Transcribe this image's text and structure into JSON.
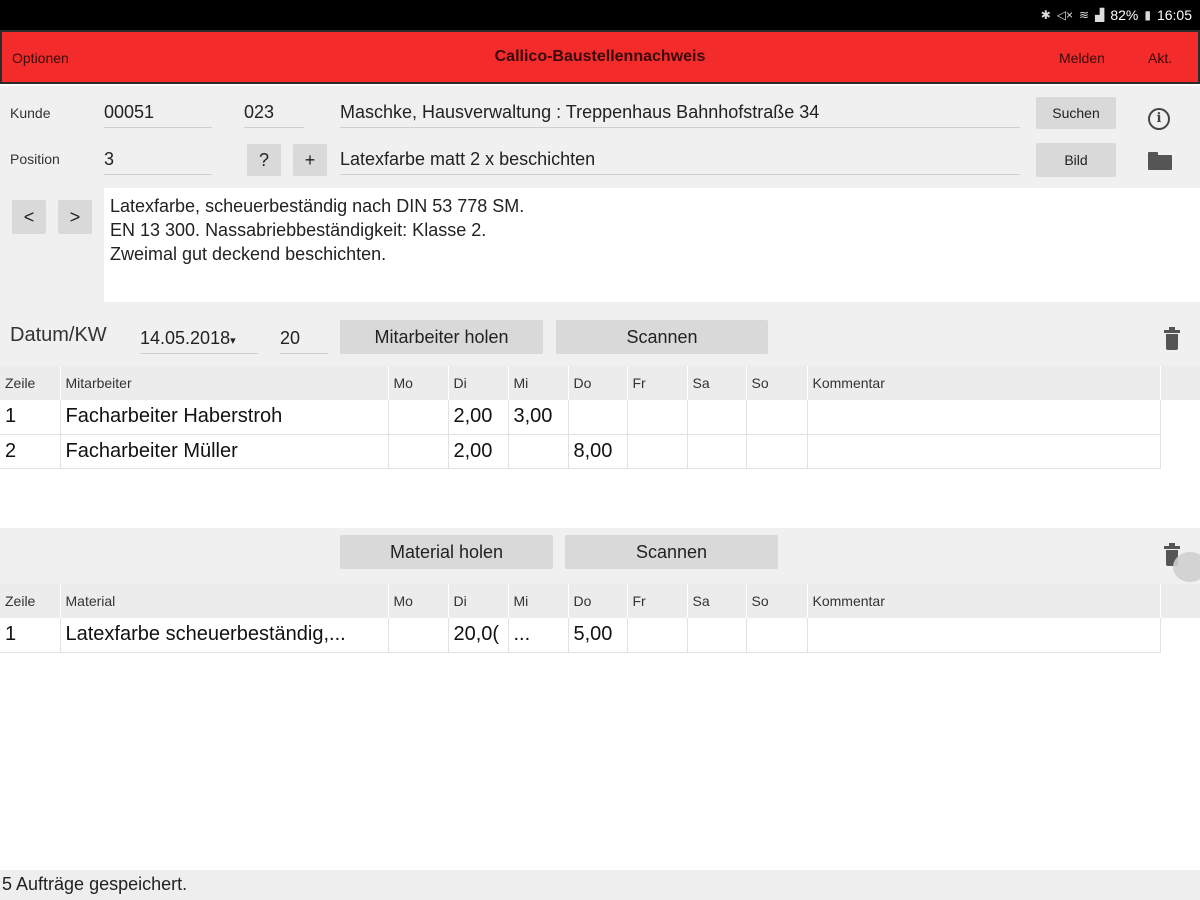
{
  "status": {
    "icons": [
      "bluetooth-icon",
      "mute-icon",
      "wifi-icon",
      "signal-icon",
      "battery-icon"
    ],
    "battery": "82%",
    "time": "16:05"
  },
  "appbar": {
    "options": "Optionen",
    "title": "Callico-Baustellennachweis",
    "melden": "Melden",
    "akt": "Akt."
  },
  "header": {
    "kunde_label": "Kunde",
    "kunde_nr": "00051",
    "kunde_sub": "023",
    "kunde_name": "Maschke, Hausverwaltung : Treppenhaus Bahnhofstraße 34",
    "suchen": "Suchen",
    "position_label": "Position",
    "position_nr": "3",
    "question_btn": "?",
    "plus_btn": "+",
    "position_text": "Latexfarbe matt 2 x beschichten",
    "bild": "Bild",
    "prev_btn": "<",
    "next_btn": ">",
    "description": [
      "Latexfarbe, scheuerbeständig nach DIN 53 778 SM.",
      "EN 13 300. Nassabriebbeständigkeit: Klasse 2.",
      "Zweimal gut deckend beschichten."
    ]
  },
  "employees": {
    "datum_label": "Datum/KW",
    "datum_value": "14.05.2018",
    "kw_value": "20",
    "fetch_button": "Mitarbeiter holen",
    "scan_button": "Scannen",
    "columns": [
      "Zeile",
      "Mitarbeiter",
      "Mo",
      "Di",
      "Mi",
      "Do",
      "Fr",
      "Sa",
      "So",
      "Kommentar"
    ],
    "rows": [
      [
        "1",
        "Facharbeiter Haberstroh",
        "",
        "2,00",
        "3,00",
        "",
        "",
        "",
        "",
        ""
      ],
      [
        "2",
        "Facharbeiter Müller",
        "",
        "2,00",
        "",
        "8,00",
        "",
        "",
        "",
        ""
      ]
    ]
  },
  "materials": {
    "fetch_button": "Material holen",
    "scan_button": "Scannen",
    "columns": [
      "Zeile",
      "Material",
      "Mo",
      "Di",
      "Mi",
      "Do",
      "Fr",
      "Sa",
      "So",
      "Kommentar"
    ],
    "rows": [
      [
        "1",
        "Latexfarbe scheuerbeständig,...",
        "",
        "20,0(",
        "...",
        "5,00",
        "",
        "",
        "",
        ""
      ]
    ]
  },
  "footer": {
    "message": "5 Aufträge gespeichert."
  }
}
